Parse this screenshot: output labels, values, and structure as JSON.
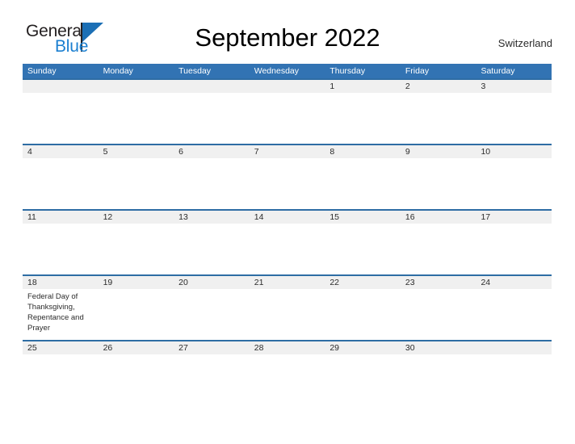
{
  "brand": {
    "name_part1": "General",
    "name_part2": "Blue",
    "flag_icon": "blue-flag-icon"
  },
  "header": {
    "title": "September 2022",
    "region": "Switzerland"
  },
  "calendar": {
    "month": "September",
    "year": "2022",
    "weekday_headers": [
      "Sunday",
      "Monday",
      "Tuesday",
      "Wednesday",
      "Thursday",
      "Friday",
      "Saturday"
    ],
    "colors": {
      "header_blue": "#3273b3",
      "row_divider_blue": "#2e6da4",
      "day_band_gray": "#f0f0f0",
      "brand_blue": "#1b7fd0",
      "text_dark": "#2b2b2b"
    },
    "weeks": [
      [
        {
          "day": "",
          "events": ""
        },
        {
          "day": "",
          "events": ""
        },
        {
          "day": "",
          "events": ""
        },
        {
          "day": "",
          "events": ""
        },
        {
          "day": "1",
          "events": ""
        },
        {
          "day": "2",
          "events": ""
        },
        {
          "day": "3",
          "events": ""
        }
      ],
      [
        {
          "day": "4",
          "events": ""
        },
        {
          "day": "5",
          "events": ""
        },
        {
          "day": "6",
          "events": ""
        },
        {
          "day": "7",
          "events": ""
        },
        {
          "day": "8",
          "events": ""
        },
        {
          "day": "9",
          "events": ""
        },
        {
          "day": "10",
          "events": ""
        }
      ],
      [
        {
          "day": "11",
          "events": ""
        },
        {
          "day": "12",
          "events": ""
        },
        {
          "day": "13",
          "events": ""
        },
        {
          "day": "14",
          "events": ""
        },
        {
          "day": "15",
          "events": ""
        },
        {
          "day": "16",
          "events": ""
        },
        {
          "day": "17",
          "events": ""
        }
      ],
      [
        {
          "day": "18",
          "events": "Federal Day of Thanksgiving, Repentance and Prayer"
        },
        {
          "day": "19",
          "events": ""
        },
        {
          "day": "20",
          "events": ""
        },
        {
          "day": "21",
          "events": ""
        },
        {
          "day": "22",
          "events": ""
        },
        {
          "day": "23",
          "events": ""
        },
        {
          "day": "24",
          "events": ""
        }
      ],
      [
        {
          "day": "25",
          "events": ""
        },
        {
          "day": "26",
          "events": ""
        },
        {
          "day": "27",
          "events": ""
        },
        {
          "day": "28",
          "events": ""
        },
        {
          "day": "29",
          "events": ""
        },
        {
          "day": "30",
          "events": ""
        },
        {
          "day": "",
          "events": ""
        }
      ]
    ]
  }
}
